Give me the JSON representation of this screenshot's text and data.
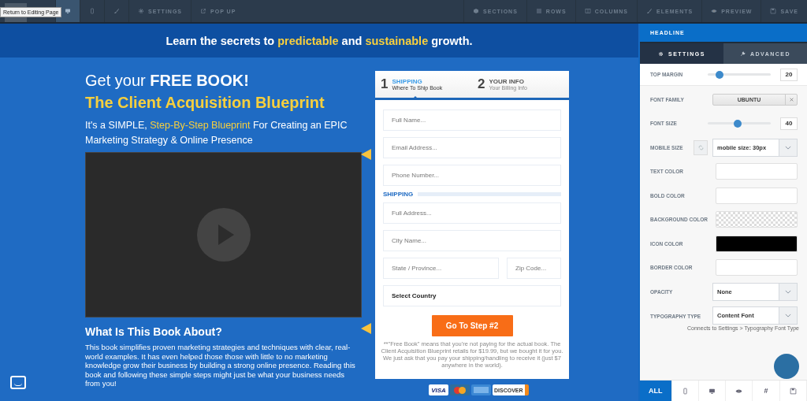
{
  "toolbar": {
    "tooltip": "Return to Editing Page",
    "left": [
      {
        "kind": "desktop",
        "selected": true
      },
      {
        "kind": "mobile",
        "selected": false
      },
      {
        "kind": "brush",
        "selected": false
      },
      {
        "kind": "gear",
        "label": "SETTINGS",
        "selected": false
      },
      {
        "kind": "popup",
        "label": "POP UP",
        "selected": false
      }
    ],
    "right": [
      {
        "kind": "sections",
        "label": "SECTIONS"
      },
      {
        "kind": "rows",
        "label": "ROWS"
      },
      {
        "kind": "columns",
        "label": "COLUMNS"
      },
      {
        "kind": "brush",
        "label": "ELEMENTS"
      },
      {
        "kind": "eye",
        "label": "PREVIEW"
      },
      {
        "kind": "save",
        "label": "SAVE"
      }
    ]
  },
  "banner": [
    {
      "text": "Learn the secrets to ",
      "highlight": false
    },
    {
      "text": "predictable",
      "highlight": true
    },
    {
      "text": " and ",
      "highlight": false
    },
    {
      "text": "sustainable",
      "highlight": true
    },
    {
      "text": " growth.",
      "highlight": false
    }
  ],
  "headline": "Get your **FREE BOOK!**",
  "book_title": "The Client Acquisition Blueprint",
  "subtitle": [
    {
      "text": "It's a SIMPLE, ",
      "highlight": false
    },
    {
      "text": "Step-By-Step Blueprint",
      "highlight": true
    },
    {
      "text": " For Creating an EPIC Marketing Strategy & Online Presence",
      "highlight": false
    }
  ],
  "about": {
    "heading": "What Is This Book About?",
    "body": "This book simplifies proven marketing strategies and techniques with clear, real-world examples. It has even helped those those with little to no marketing knowledge grow their business by building a strong online presence. Reading this book and following these simple steps might just be what your business needs from you!"
  },
  "form": {
    "steps": [
      {
        "number": "1",
        "title": "SHIPPING",
        "subtitle": "Where To Ship Book",
        "selected": true
      },
      {
        "number": "2",
        "title": "YOUR INFO",
        "subtitle": "Your Billing Info",
        "selected": false
      }
    ],
    "fields": [
      {
        "kind": "input",
        "placeholder": "Full Name..."
      },
      {
        "kind": "input",
        "placeholder": "Email Address..."
      },
      {
        "kind": "input",
        "placeholder": "Phone Number..."
      },
      {
        "kind": "section",
        "label": "SHIPPING"
      },
      {
        "kind": "input",
        "placeholder": "Full Address..."
      },
      {
        "kind": "input",
        "placeholder": "City Name..."
      },
      {
        "kind": "pair",
        "fields": [
          {
            "placeholder": "State / Province..."
          },
          {
            "placeholder": "Zip Code..."
          }
        ]
      },
      {
        "kind": "select",
        "value": "Select Country"
      }
    ],
    "button": "Go To Step #2",
    "disclaimer": "**\"Free Book\" means that you're not paying for the actual book. The Client Acquisition Blueprint retails for $19.99, but we bought it for you. We just ask that you pay your shipping/handling to receive it (just $7 anywhere in the world).",
    "cards": [
      {
        "kind": "visa",
        "label": "VISA"
      },
      {
        "kind": "mastercard"
      },
      {
        "kind": "amex"
      },
      {
        "kind": "discover",
        "label": "DISCOVER"
      }
    ]
  },
  "panel": {
    "title": "HEADLINE",
    "tabs": [
      {
        "kind": "gear",
        "label": "SETTINGS",
        "selected": true
      },
      {
        "kind": "wrench",
        "label": "ADVANCED",
        "selected": false
      }
    ],
    "rows": [
      {
        "kind": "slider",
        "label": "TOP MARGIN",
        "level": 0.19,
        "value": "20"
      },
      {
        "kind": "font",
        "label": "FONT FAMILY",
        "value": "UBUNTU"
      },
      {
        "kind": "slider",
        "label": "FONT SIZE",
        "level": 0.47,
        "value": "40"
      },
      {
        "kind": "select",
        "label": "MOBILE SIZE",
        "value": "mobile size: 30px",
        "linked": true
      },
      {
        "kind": "swatch",
        "label": "TEXT COLOR",
        "color": "#ffffff"
      },
      {
        "kind": "swatch",
        "label": "BOLD COLOR",
        "color": "#ffffff"
      },
      {
        "kind": "swatch",
        "label": "BACKGROUND COLOR",
        "transparent": true
      },
      {
        "kind": "swatch",
        "label": "ICON COLOR",
        "color": "#000000"
      },
      {
        "kind": "swatch",
        "label": "BORDER COLOR",
        "color": "#ffffff"
      },
      {
        "kind": "select",
        "label": "OPACITY",
        "value": "None"
      },
      {
        "kind": "select",
        "label": "TYPOGRAPHY TYPE",
        "value": "Content Font",
        "note": "Connects to Settings > Typography Font Type"
      }
    ],
    "bottom_tabs": [
      {
        "kind": "all",
        "label": "ALL",
        "selected": true
      },
      {
        "kind": "mobile",
        "selected": false
      },
      {
        "kind": "desktop",
        "selected": false
      },
      {
        "kind": "eye",
        "selected": false
      },
      {
        "kind": "hash",
        "label": "#",
        "selected": false
      },
      {
        "kind": "save",
        "selected": false
      }
    ]
  }
}
